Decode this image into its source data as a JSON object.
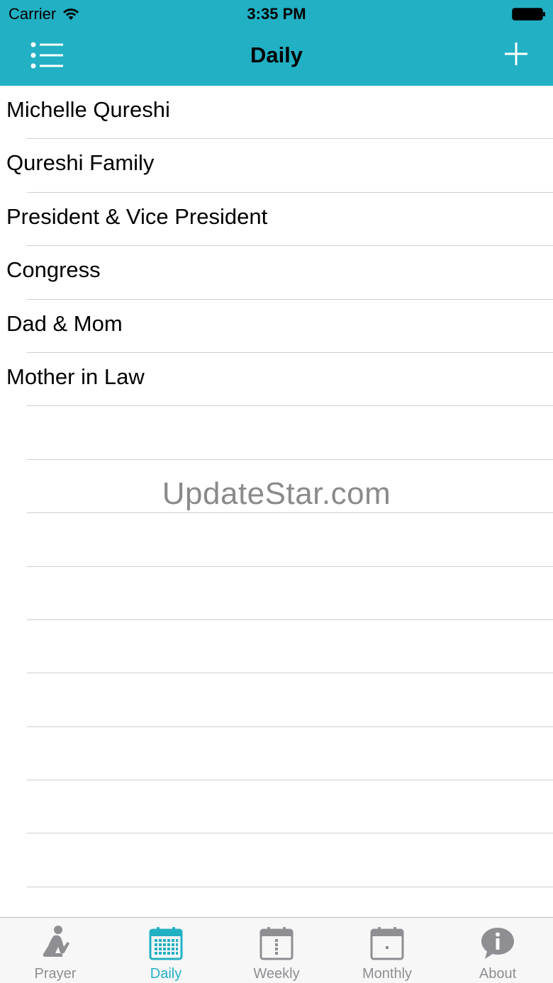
{
  "status_bar": {
    "carrier": "Carrier",
    "time": "3:35 PM",
    "wifi_icon": "wifi-icon",
    "battery_icon": "battery-icon"
  },
  "nav_bar": {
    "title": "Daily",
    "left_icon": "list-menu-icon",
    "right_icon": "plus-icon"
  },
  "list": {
    "items": [
      "Michelle Qureshi",
      "Qureshi Family",
      "President & Vice President",
      "Congress",
      "Dad & Mom",
      "Mother in Law"
    ]
  },
  "watermark": "UpdateStar.com",
  "tab_bar": {
    "active_color": "#22b0c4",
    "inactive_color": "#8e8e93",
    "tabs": [
      {
        "label": "Prayer",
        "icon": "praying-person-icon",
        "active": false
      },
      {
        "label": "Daily",
        "icon": "daily-calendar-icon",
        "active": true
      },
      {
        "label": "Weekly",
        "icon": "weekly-calendar-icon",
        "active": false
      },
      {
        "label": "Monthly",
        "icon": "monthly-calendar-icon",
        "active": false
      },
      {
        "label": "About",
        "icon": "info-bubble-icon",
        "active": false
      }
    ]
  },
  "colors": {
    "header": "#22b0c4",
    "separator": "#cfcfd4",
    "tab_bar_bg": "#f7f7f7"
  }
}
